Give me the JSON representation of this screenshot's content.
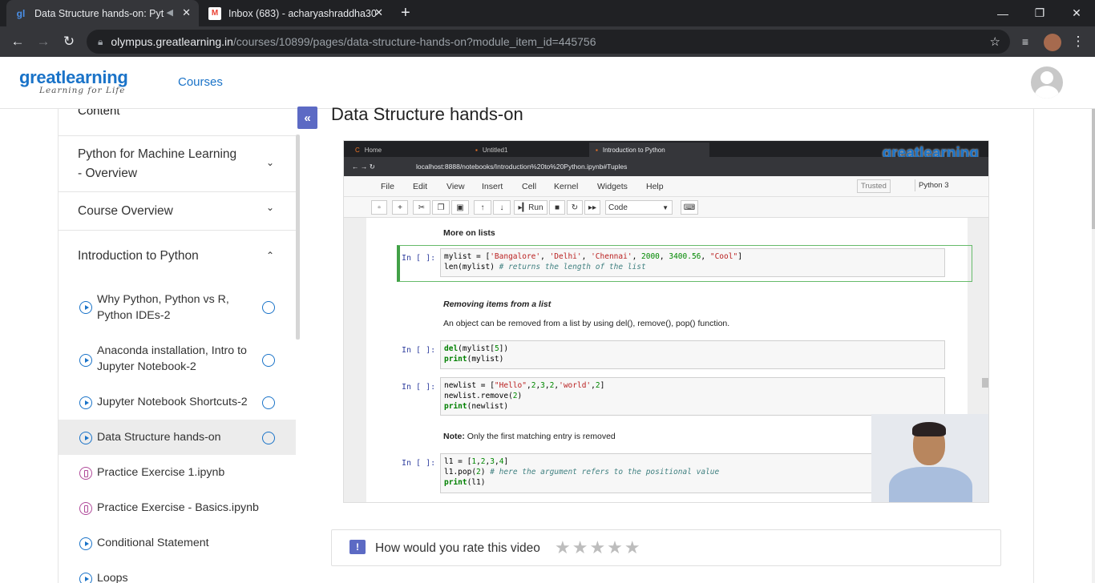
{
  "browser": {
    "tabs": [
      {
        "title": "Data Structure hands-on: Pyt",
        "favicon": "gl-icon",
        "active": true
      },
      {
        "title": "Inbox (683) - acharyashraddha30",
        "favicon": "gmail-icon",
        "active": false
      }
    ],
    "new_tab": "+",
    "url_host": "olympus.greatlearning.in",
    "url_path": "/courses/10899/pages/data-structure-hands-on?module_item_id=445756",
    "window_controls": [
      "—",
      "❐",
      "✕"
    ]
  },
  "header": {
    "logo_name": "greatlearning",
    "logo_tagline": "Learning for Life",
    "nav_courses": "Courses"
  },
  "sidebar": {
    "title": "Content",
    "sections": [
      {
        "label_line1": "Python for Machine Learning",
        "label_line2": "- Overview",
        "chevron": "⌄"
      },
      {
        "label": "Course Overview",
        "chevron": "⌄"
      },
      {
        "label": "Introduction to Python",
        "chevron": "⌃"
      }
    ],
    "items": [
      {
        "line1": "Why Python, Python vs R,",
        "line2": "Python IDEs-2",
        "icon": "play-icon"
      },
      {
        "line1": "Anaconda installation, Intro to",
        "line2": "Jupyter Notebook-2",
        "icon": "play-icon"
      },
      {
        "line1": "Jupyter Notebook Shortcuts-2",
        "icon": "play-icon"
      },
      {
        "line1": "Data Structure hands-on",
        "icon": "play-icon",
        "selected": true
      },
      {
        "line1": "Practice Exercise 1.ipynb",
        "icon": "notebook-icon"
      },
      {
        "line1": "Practice Exercise - Basics.ipynb",
        "icon": "notebook-icon"
      },
      {
        "line1": "Conditional Statement",
        "icon": "play-icon"
      },
      {
        "line1": "Loops",
        "icon": "play-icon"
      }
    ],
    "collapse_label": "«"
  },
  "main": {
    "page_title": "Data Structure hands-on"
  },
  "video": {
    "jupyter_tabs": [
      "Home",
      "Untitled1",
      "Introduction to Python"
    ],
    "jupyter_url": "localhost:8888/notebooks/Introduction%20to%20Python.ipynb#Tuples",
    "watermark": "greatlearning",
    "menu": [
      "File",
      "Edit",
      "View",
      "Insert",
      "Cell",
      "Kernel",
      "Widgets",
      "Help"
    ],
    "trusted": "Trusted",
    "kernel": "Python 3",
    "run_label": "Run",
    "cell_type": "Code",
    "heading_more_lists": "More on lists",
    "prompt": "In [ ]:",
    "heading_removing": "Removing items from a list",
    "para_removing": "An object can be removed from a list by using del(), remove(), pop() function.",
    "note_bold": "Note:",
    "note_text": " Only the first matching entry is removed"
  },
  "rating": {
    "question": "How would you rate this video",
    "stars": "★★★★★",
    "max_stars": 5,
    "selected_stars": 0
  },
  "colors": {
    "brand_blue": "#1a73c8",
    "accent_purple": "#5c6ac4",
    "selected_cell": "#42a047"
  }
}
